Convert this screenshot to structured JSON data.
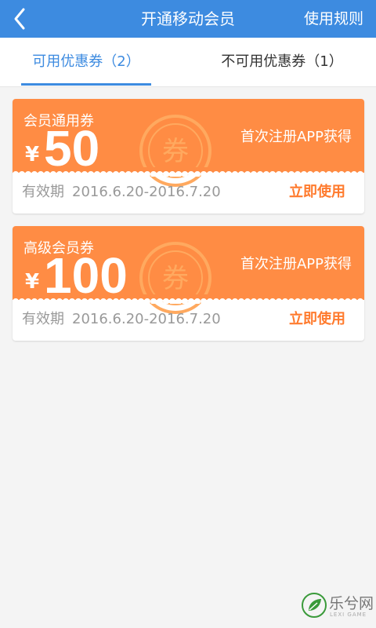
{
  "header": {
    "title": "开通移动会员",
    "right_link": "使用规则"
  },
  "tabs": [
    {
      "label": "可用优惠券（2）",
      "active": true
    },
    {
      "label": "不可用优惠券（1）",
      "active": false
    }
  ],
  "coupons": [
    {
      "name": "会员通用券",
      "currency": "¥",
      "amount": "50",
      "source": "首次注册APP获得",
      "validity_label": "有效期",
      "validity_dates": "2016.6.20-2016.7.20",
      "action": "立即使用",
      "stamp_char": "券"
    },
    {
      "name": "高级会员券",
      "currency": "¥",
      "amount": "100",
      "source": "首次注册APP获得",
      "validity_label": "有效期",
      "validity_dates": "2016.6.20-2016.7.20",
      "action": "立即使用",
      "stamp_char": "券"
    }
  ],
  "watermark": {
    "text": "乐兮网",
    "sub": "LEXI GAME"
  },
  "colors": {
    "header_bg": "#3d8be0",
    "accent": "#3d8be0",
    "coupon_orange": "#ff8c44",
    "action_orange": "#ff7b2e"
  },
  "icons": {
    "back": "chevron-left-icon",
    "stamp": "coupon-stamp-icon",
    "watermark": "leaf-logo-icon"
  }
}
